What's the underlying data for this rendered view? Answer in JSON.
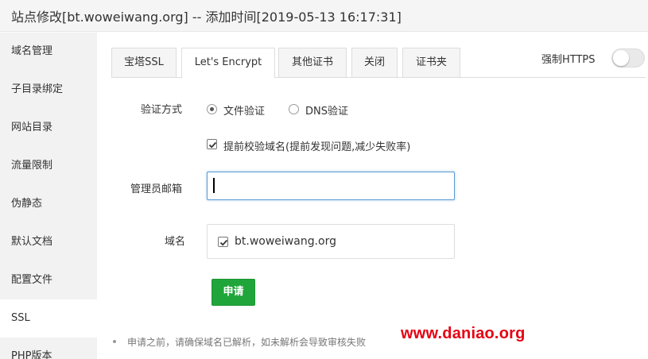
{
  "window": {
    "title": "站点修改[bt.woweiwang.org] -- 添加时间[2019-05-13 16:17:31]"
  },
  "sidebar": {
    "items": [
      {
        "label": "域名管理"
      },
      {
        "label": "子目录绑定"
      },
      {
        "label": "网站目录"
      },
      {
        "label": "流量限制"
      },
      {
        "label": "伪静态"
      },
      {
        "label": "默认文档"
      },
      {
        "label": "配置文件"
      },
      {
        "label": "SSL",
        "active": true
      },
      {
        "label": "PHP版本"
      }
    ]
  },
  "tabs": [
    {
      "label": "宝塔SSL"
    },
    {
      "label": "Let's Encrypt",
      "active": true
    },
    {
      "label": "其他证书"
    },
    {
      "label": "关闭"
    },
    {
      "label": "证书夹"
    }
  ],
  "force_https": {
    "label": "强制HTTPS",
    "enabled": false
  },
  "form": {
    "verify_label": "验证方式",
    "verify_options": [
      {
        "label": "文件验证",
        "checked": true
      },
      {
        "label": "DNS验证",
        "checked": false
      }
    ],
    "precheck": {
      "label": "提前校验域名(提前发现问题,减少失败率)",
      "checked": true
    },
    "email_label": "管理员邮箱",
    "email_value": "",
    "domain_label": "域名",
    "domains": [
      {
        "name": "bt.woweiwang.org",
        "checked": true
      }
    ],
    "apply_label": "申请"
  },
  "notes": [
    "申请之前，请确保域名已解析，如未解析会导致审核失败"
  ],
  "watermark": "www.daniao.org",
  "colors": {
    "accent_green": "#20a53a",
    "input_focus": "#5b9bd5",
    "watermark_red": "#e60012"
  }
}
